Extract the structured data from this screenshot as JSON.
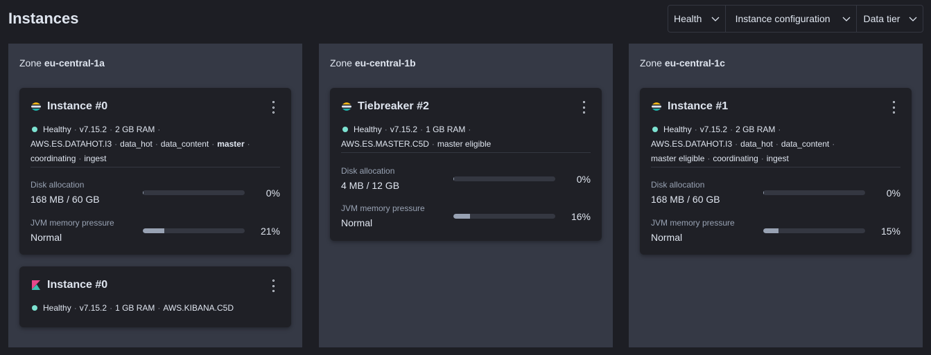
{
  "header": {
    "title": "Instances",
    "filters": [
      "Health",
      "Instance configuration",
      "Data tier"
    ]
  },
  "zones": [
    {
      "prefix": "Zone",
      "name": "eu-central-1a",
      "cards": [
        {
          "icon": "elasticsearch-logo-icon",
          "title": "Instance #0",
          "meta_line1": [
            "Healthy",
            "v7.15.2",
            "2 GB RAM"
          ],
          "meta_line2": [
            "AWS.ES.DATAHOT.I3",
            "data_hot",
            "data_content",
            "master"
          ],
          "meta_line3": [
            "coordinating",
            "ingest"
          ],
          "disk": {
            "label": "Disk allocation",
            "value": "168 MB / 60 GB",
            "percent": "0%",
            "fraction": 0.0
          },
          "jvm": {
            "label": "JVM memory pressure",
            "value": "Normal",
            "percent": "21%",
            "fraction": 0.21
          }
        },
        {
          "icon": "kibana-logo-icon",
          "title": "Instance #0",
          "meta_line1": [
            "Healthy",
            "v7.15.2",
            "1 GB RAM",
            "AWS.KIBANA.C5D"
          ]
        }
      ]
    },
    {
      "prefix": "Zone",
      "name": "eu-central-1b",
      "cards": [
        {
          "icon": "elasticsearch-logo-icon",
          "title": "Tiebreaker #2",
          "meta_line1": [
            "Healthy",
            "v7.15.2",
            "1 GB RAM"
          ],
          "meta_line2": [
            "AWS.ES.MASTER.C5D",
            "master eligible"
          ],
          "disk": {
            "label": "Disk allocation",
            "value": "4 MB / 12 GB",
            "percent": "0%",
            "fraction": 0.0
          },
          "jvm": {
            "label": "JVM memory pressure",
            "value": "Normal",
            "percent": "16%",
            "fraction": 0.16
          }
        }
      ]
    },
    {
      "prefix": "Zone",
      "name": "eu-central-1c",
      "cards": [
        {
          "icon": "elasticsearch-logo-icon",
          "title": "Instance #1",
          "meta_line1": [
            "Healthy",
            "v7.15.2",
            "2 GB RAM"
          ],
          "meta_line2": [
            "AWS.ES.DATAHOT.I3",
            "data_hot",
            "data_content"
          ],
          "meta_line3": [
            "master eligible",
            "coordinating",
            "ingest"
          ],
          "disk": {
            "label": "Disk allocation",
            "value": "168 MB / 60 GB",
            "percent": "0%",
            "fraction": 0.0
          },
          "jvm": {
            "label": "JVM memory pressure",
            "value": "Normal",
            "percent": "15%",
            "fraction": 0.15
          }
        }
      ]
    }
  ],
  "colors": {
    "healthy_dot": "#7de2d1",
    "panel_bg": "#353945",
    "card_bg": "#1f2026",
    "page_bg": "#1d1e24"
  }
}
